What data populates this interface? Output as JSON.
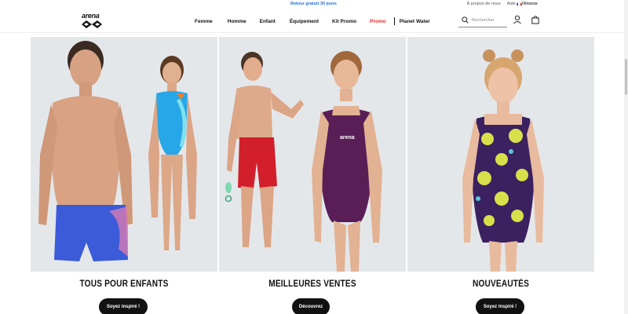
{
  "topbar": {
    "promo_message": "Retour gratuit 30 jours",
    "links": [
      "À propos de nous",
      "Aide",
      "Retours"
    ],
    "locale": "France"
  },
  "header": {
    "logo_text": "arena",
    "nav": [
      "Femme",
      "Homme",
      "Enfant",
      "Équipement",
      "Kit Promo",
      "Promo",
      "Planet Water"
    ],
    "search_placeholder": "Rechercher"
  },
  "tiles": [
    {
      "title": "TOUS POUR ENFANTS",
      "button": "Soyez inspiré !"
    },
    {
      "title": "MEILLEURES VENTES",
      "button": "Découvrez"
    },
    {
      "title": "NOUVEAUTÉS",
      "button": "Soyez inspiré !"
    }
  ],
  "colors": {
    "accent_blue": "#1f6fd0",
    "promo_red": "#e0262a",
    "tile_bg": "#e4e7ea",
    "button_bg": "#111111"
  },
  "icons": [
    "search-icon",
    "user-icon",
    "bag-icon",
    "flag-fr-icon"
  ]
}
